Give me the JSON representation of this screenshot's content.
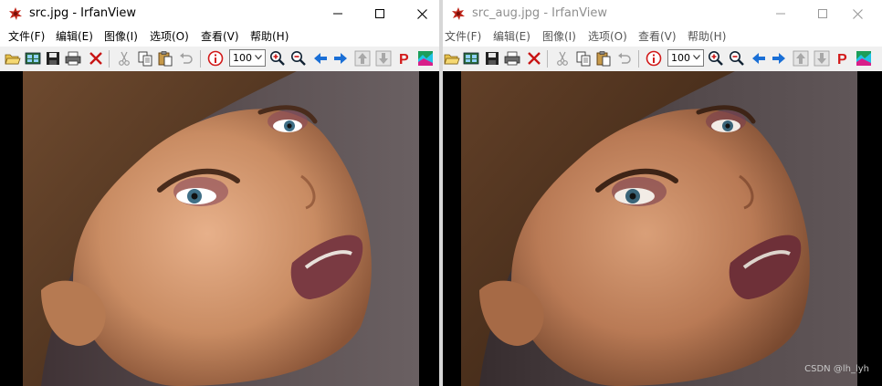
{
  "windows": [
    {
      "title": "src.jpg - IrfanView",
      "active": true,
      "menu": [
        "文件(F)",
        "编辑(E)",
        "图像(I)",
        "选项(O)",
        "查看(V)",
        "帮助(H)"
      ],
      "zoom_value": "100",
      "watermark": ""
    },
    {
      "title": "src_aug.jpg - IrfanView",
      "active": false,
      "menu": [
        "文件(F)",
        "编辑(E)",
        "图像(I)",
        "选项(O)",
        "查看(V)",
        "帮助(H)"
      ],
      "zoom_value": "100",
      "watermark": "CSDN @lh_lyh"
    }
  ],
  "toolbar_icons": [
    "open-folder-icon",
    "thumbnails-icon",
    "save-icon",
    "print-icon",
    "delete-icon",
    "cut-icon",
    "copy-icon",
    "paste-icon",
    "undo-icon",
    "info-icon",
    "zoom-in-icon",
    "zoom-out-icon",
    "previous-icon",
    "next-icon",
    "first-icon",
    "last-icon",
    "paint-icon",
    "slideshow-icon"
  ],
  "colors": {
    "title_active": "#000000",
    "title_inactive": "#8f8f8f",
    "toolbar_bg": "#f0f0f0",
    "viewer_bg": "#000000",
    "photo_background": "#5a5052",
    "skin_src": "#c98c63",
    "skin_aug": "#b97a55"
  }
}
